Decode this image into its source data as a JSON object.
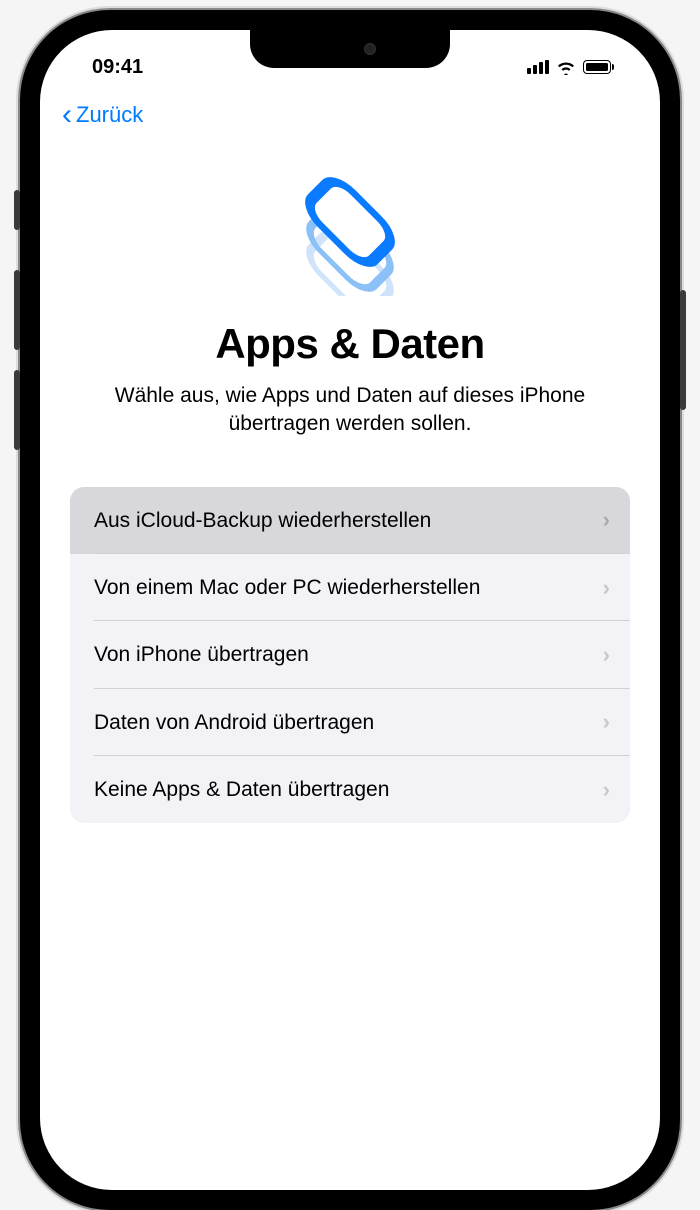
{
  "status_bar": {
    "time": "09:41"
  },
  "nav": {
    "back_label": "Zurück"
  },
  "page": {
    "title": "Apps & Daten",
    "subtitle": "Wähle aus, wie Apps und Daten auf dieses iPhone übertragen werden sollen."
  },
  "options": [
    {
      "label": "Aus iCloud-Backup wiederherstellen",
      "selected": true
    },
    {
      "label": "Von einem Mac oder PC wiederherstellen",
      "selected": false
    },
    {
      "label": "Von iPhone übertragen",
      "selected": false
    },
    {
      "label": "Daten von Android übertragen",
      "selected": false
    },
    {
      "label": "Keine Apps & Daten übertragen",
      "selected": false
    }
  ]
}
